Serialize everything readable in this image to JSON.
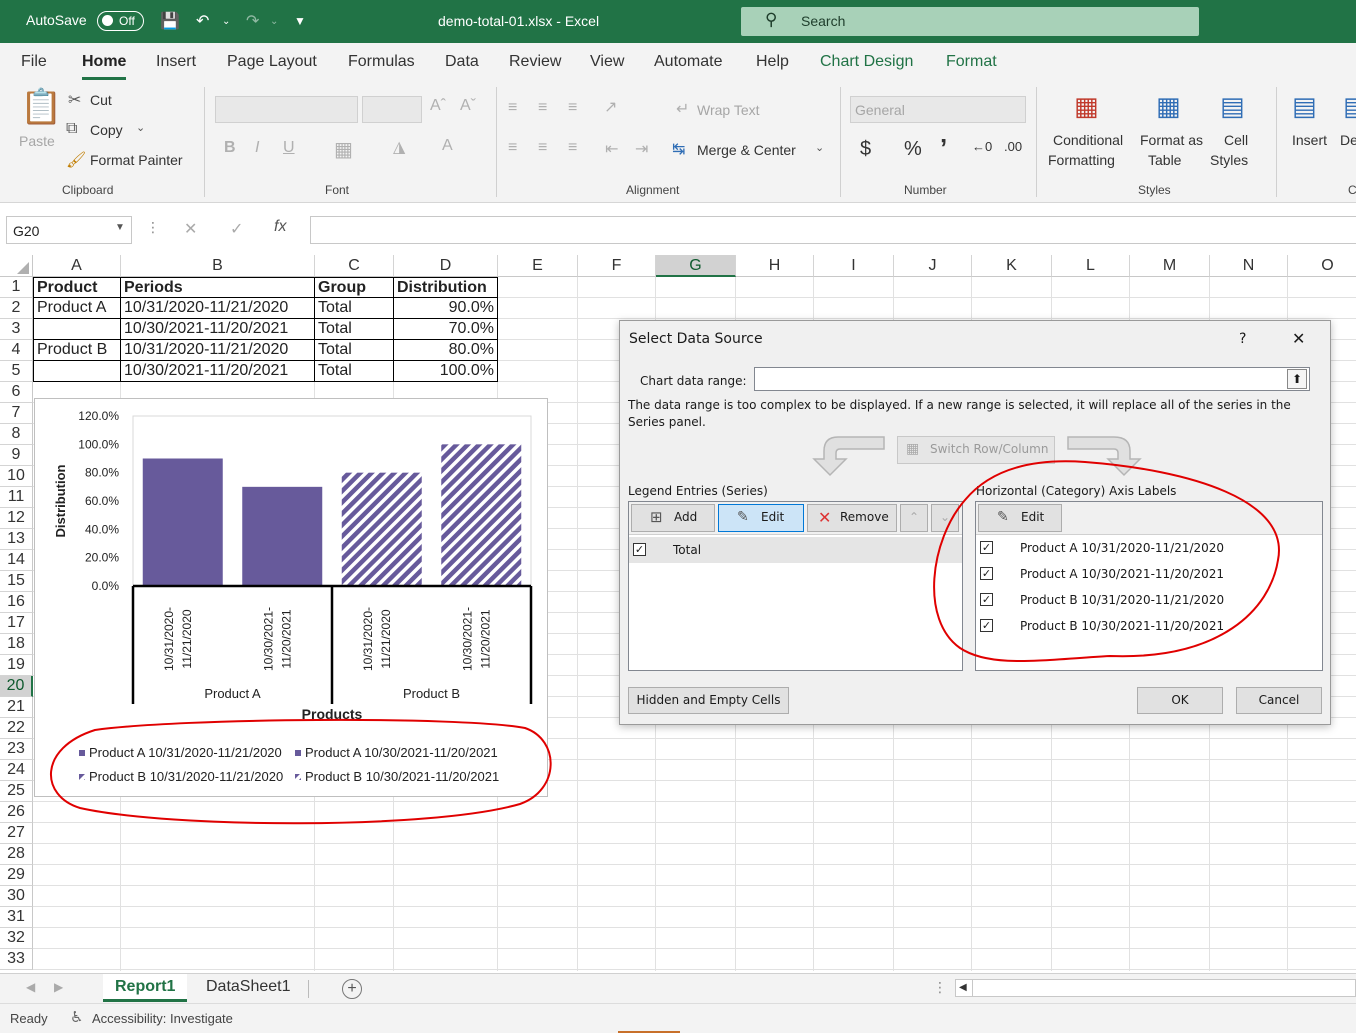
{
  "titlebar": {
    "autosave_label": "AutoSave",
    "autosave_state": "Off",
    "doc_title": "demo-total-01.xlsx  -  Excel",
    "search_placeholder": "Search"
  },
  "menu": [
    "File",
    "Home",
    "Insert",
    "Page Layout",
    "Formulas",
    "Data",
    "Review",
    "View",
    "Automate",
    "Help",
    "Chart Design",
    "Format"
  ],
  "ribbon": {
    "clipboard": {
      "paste": "Paste",
      "cut": "Cut",
      "copy": "Copy",
      "format_painter": "Format Painter",
      "group": "Clipboard"
    },
    "font": {
      "bold": "B",
      "italic": "I",
      "underline": "U",
      "group": "Font"
    },
    "alignment": {
      "wrap_text": "Wrap Text",
      "merge_center": "Merge & Center",
      "group": "Alignment"
    },
    "number": {
      "format": "General",
      "currency": "$",
      "percent": "%",
      "comma": "’",
      "group": "Number"
    },
    "styles": {
      "conditional": "Conditional",
      "formatting": "Formatting",
      "format_as": "Format as",
      "table": "Table",
      "cell": "Cell",
      "cell_styles": "Styles",
      "group": "Styles"
    },
    "cells": {
      "insert": "Insert",
      "delete": "De",
      "group": "C"
    }
  },
  "formula_bar": {
    "name_box": "G20",
    "fx": "fx",
    "value": ""
  },
  "columns": [
    "A",
    "B",
    "C",
    "D",
    "E",
    "F",
    "G",
    "H",
    "I",
    "J",
    "K",
    "L",
    "M",
    "N",
    "O"
  ],
  "rows": [
    "1",
    "2",
    "3",
    "4",
    "5",
    "6",
    "7",
    "8",
    "9",
    "10",
    "11",
    "12",
    "13",
    "14",
    "15",
    "16",
    "17",
    "18",
    "19",
    "20",
    "21",
    "22",
    "23",
    "24",
    "25",
    "26",
    "27",
    "28",
    "29",
    "30",
    "31",
    "32",
    "33"
  ],
  "table": {
    "headers": [
      "Product",
      "Periods",
      "Group",
      "Distribution"
    ],
    "rows": [
      [
        "Product A",
        "10/31/2020-11/21/2020",
        "Total",
        "90.0%"
      ],
      [
        "",
        "10/30/2021-11/20/2021",
        "Total",
        "70.0%"
      ],
      [
        "Product B",
        "10/31/2020-11/21/2020",
        "Total",
        "80.0%"
      ],
      [
        "",
        "10/30/2021-11/20/2021",
        "Total",
        "100.0%"
      ]
    ]
  },
  "chart_data": {
    "type": "bar",
    "categories": [
      "10/31/2020-11/21/2020",
      "10/30/2021-11/20/2021",
      "10/31/2020-11/21/2020",
      "10/30/2021-11/20/2021"
    ],
    "groups": [
      "Product A",
      "Product B"
    ],
    "values": [
      90,
      70,
      80,
      100
    ],
    "fills": [
      "solid",
      "solid",
      "hatched",
      "hatched"
    ],
    "bar_color": "#675a9b",
    "y_ticks": [
      "120.0%",
      "100.0%",
      "80.0%",
      "60.0%",
      "40.0%",
      "20.0%",
      "0.0%"
    ],
    "ylim": [
      0,
      120
    ],
    "ylabel": "Distribution",
    "xlabel": "Products",
    "legend": [
      "Product A 10/31/2020-11/21/2020",
      "Product A 10/30/2021-11/20/2021",
      "Product B 10/31/2020-11/21/2020",
      "Product B 10/30/2021-11/20/2021"
    ],
    "legend_position": "bottom"
  },
  "sheets": {
    "tabs": [
      "Report1",
      "DataSheet1"
    ],
    "active": "Report1"
  },
  "status": {
    "ready": "Ready",
    "accessibility": "Accessibility: Investigate"
  },
  "dialog": {
    "title": "Select Data Source",
    "help": "?",
    "close": "✕",
    "chart_range_label": "Chart data range:",
    "message": "The data range is too complex to be displayed. If a new range is selected, it will replace all of the series in the Series panel.",
    "switch_label": "Switch Row/Column",
    "legend_label": "Legend Entries (Series)",
    "add": "Add",
    "edit": "Edit",
    "remove": "Remove",
    "series": [
      "Total"
    ],
    "axis_label": "Horizontal (Category) Axis Labels",
    "axis_edit": "Edit",
    "axis_items": [
      "Product A 10/31/2020-11/21/2020",
      "Product A 10/30/2021-11/20/2021",
      "Product B 10/31/2020-11/21/2020",
      "Product B 10/30/2021-11/20/2021"
    ],
    "hidden_cells": "Hidden and Empty Cells",
    "ok": "OK",
    "cancel": "Cancel"
  }
}
